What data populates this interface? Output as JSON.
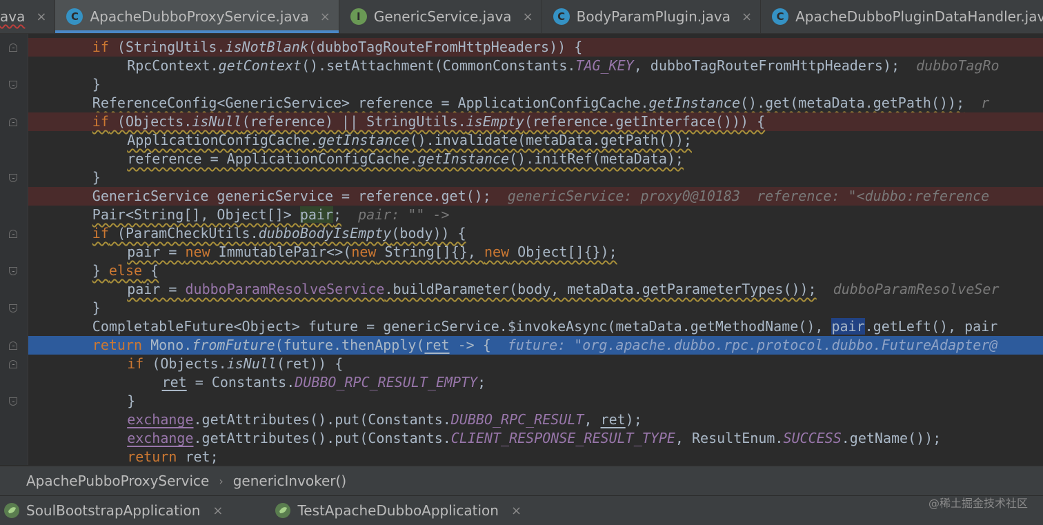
{
  "editor_tabs": [
    {
      "label": "ava",
      "type": "partial",
      "error": true
    },
    {
      "label": "ApacheDubboProxyService.java",
      "icon": "class-icon",
      "icon_letter": "C",
      "active": true
    },
    {
      "label": "GenericService.java",
      "icon": "interface-icon",
      "icon_letter": "I",
      "active": false
    },
    {
      "label": "BodyParamPlugin.java",
      "icon": "class-icon",
      "icon_letter": "C",
      "active": false
    },
    {
      "label": "ApacheDubboPluginDataHandler.java",
      "icon": "class-icon",
      "icon_letter": "C",
      "active": false
    }
  ],
  "tab_close_glyph": "×",
  "colors": {
    "class_icon": "#3592c4",
    "interface_icon": "#6a9955",
    "keyword": "#cc7832",
    "selection": "#2d5b9c",
    "breakpoint_line": "#4a2b2b"
  },
  "code": {
    "lines": [
      {
        "indent": 2,
        "highlight": "red",
        "fold": "down",
        "tokens": [
          {
            "t": "if",
            "c": "kw"
          },
          {
            "t": " (StringUtils."
          },
          {
            "t": "isNotBlank",
            "c": "it"
          },
          {
            "t": "(dubboTagRouteFromHttpHeaders)) {"
          }
        ]
      },
      {
        "indent": 3,
        "tokens": [
          {
            "t": "RpcContext."
          },
          {
            "t": "getContext",
            "c": "it"
          },
          {
            "t": "().setAttachment(CommonConstants."
          },
          {
            "t": "TAG_KEY",
            "c": "const"
          },
          {
            "t": ", dubboTagRouteFromHttpHeaders);"
          },
          {
            "t": "  dubboTagRo",
            "c": "inlay"
          }
        ]
      },
      {
        "indent": 2,
        "fold": "up",
        "tokens": [
          {
            "t": "}"
          }
        ]
      },
      {
        "indent": 2,
        "tokens": [
          {
            "t": "ReferenceConfig<GenericService> reference = ApplicationConfigCache.",
            "c": "wavy"
          },
          {
            "t": "getInstance",
            "c": "it wavy"
          },
          {
            "t": "().get(metaData.getPath());",
            "c": "wavy"
          },
          {
            "t": "  r",
            "c": "inlay"
          }
        ]
      },
      {
        "indent": 2,
        "highlight": "red",
        "fold": "down",
        "tokens": [
          {
            "t": "if",
            "c": "kw wavy"
          },
          {
            "t": " (Objects.",
            "c": "wavy"
          },
          {
            "t": "isNull",
            "c": "it wavy"
          },
          {
            "t": "(reference) || StringUtils.",
            "c": "wavy"
          },
          {
            "t": "isEmpty",
            "c": "it wavy"
          },
          {
            "t": "(reference.getInterface())) {",
            "c": "wavy"
          }
        ]
      },
      {
        "indent": 3,
        "tokens": [
          {
            "t": "ApplicationConfigCache.",
            "c": "wavy"
          },
          {
            "t": "getInstance",
            "c": "it wavy"
          },
          {
            "t": "().invalidate(metaData.getPath());",
            "c": "wavy"
          }
        ]
      },
      {
        "indent": 3,
        "tokens": [
          {
            "t": "reference = ApplicationConfigCache.",
            "c": "wavy"
          },
          {
            "t": "getInstance",
            "c": "it wavy"
          },
          {
            "t": "().initRef(metaData);",
            "c": "wavy"
          }
        ]
      },
      {
        "indent": 2,
        "fold": "up",
        "tokens": [
          {
            "t": "}"
          }
        ]
      },
      {
        "indent": 2,
        "highlight": "red",
        "tokens": [
          {
            "t": "GenericService genericService = reference.get();"
          },
          {
            "t": "  genericService: proxy0@10183  reference: \"<dubbo:reference",
            "c": "inlay"
          }
        ]
      },
      {
        "indent": 2,
        "tokens": [
          {
            "t": "Pair<String[], Object[]> ",
            "c": "wavy"
          },
          {
            "t": "pair",
            "c": "pair-var wavy"
          },
          {
            "t": ";",
            "c": "wavy"
          },
          {
            "t": "  pair: \"\" ->",
            "c": "inlay"
          }
        ]
      },
      {
        "indent": 2,
        "fold": "down",
        "tokens": [
          {
            "t": "if",
            "c": "kw wavy"
          },
          {
            "t": " (ParamCheckUtils.",
            "c": "wavy"
          },
          {
            "t": "dubboBodyIsEmpty",
            "c": "it wavy"
          },
          {
            "t": "(body)) {",
            "c": "wavy"
          }
        ]
      },
      {
        "indent": 3,
        "tokens": [
          {
            "t": "pair = ",
            "c": "wavy"
          },
          {
            "t": "new",
            "c": "kw wavy"
          },
          {
            "t": " ImmutablePair<>(",
            "c": "wavy"
          },
          {
            "t": "new",
            "c": "kw wavy"
          },
          {
            "t": " String[]{}, ",
            "c": "wavy"
          },
          {
            "t": "new",
            "c": "kw wavy"
          },
          {
            "t": " Object[]{});",
            "c": "wavy"
          }
        ]
      },
      {
        "indent": 2,
        "fold": "up",
        "tokens": [
          {
            "t": "} ",
            "c": "wavy"
          },
          {
            "t": "else",
            "c": "kw wavy"
          },
          {
            "t": " {",
            "c": "wavy"
          }
        ]
      },
      {
        "indent": 3,
        "tokens": [
          {
            "t": "pair = ",
            "c": "wavy"
          },
          {
            "t": "dubboParamResolveService",
            "c": "field wavy"
          },
          {
            "t": ".buildParameter(body, metaData.getParameterTypes());",
            "c": "wavy"
          },
          {
            "t": "  dubboParamResolveSer",
            "c": "inlay"
          }
        ]
      },
      {
        "indent": 2,
        "fold": "up",
        "tokens": [
          {
            "t": "}"
          }
        ]
      },
      {
        "indent": 2,
        "tokens": [
          {
            "t": "CompletableFuture<Object> future = genericService.$invokeAsync(metaData.getMethodName(), "
          },
          {
            "t": "pair",
            "c": "sel-word"
          },
          {
            "t": ".getLeft(), pair"
          }
        ]
      },
      {
        "indent": 2,
        "highlight": "sel",
        "fold": "down",
        "tokens": [
          {
            "t": "return",
            "c": "kw"
          },
          {
            "t": " Mono."
          },
          {
            "t": "fromFuture",
            "c": "it"
          },
          {
            "t": "(future.thenApply("
          },
          {
            "t": "ret",
            "c": "under"
          },
          {
            "t": " -> {"
          },
          {
            "t": "  future: \"org.apache.dubbo.rpc.protocol.dubbo.FutureAdapter@",
            "c": "inlay-sel"
          }
        ]
      },
      {
        "indent": 3,
        "fold": "down",
        "tokens": [
          {
            "t": "if",
            "c": "kw"
          },
          {
            "t": " (Objects."
          },
          {
            "t": "isNull",
            "c": "it"
          },
          {
            "t": "(ret)) {"
          }
        ]
      },
      {
        "indent": 4,
        "tokens": [
          {
            "t": "ret",
            "c": "under"
          },
          {
            "t": " = Constants."
          },
          {
            "t": "DUBBO_RPC_RESULT_EMPTY",
            "c": "const"
          },
          {
            "t": ";"
          }
        ]
      },
      {
        "indent": 3,
        "fold": "up",
        "tokens": [
          {
            "t": "}"
          }
        ]
      },
      {
        "indent": 3,
        "tokens": [
          {
            "t": "exchange",
            "c": "field under"
          },
          {
            "t": ".getAttributes().put(Constants."
          },
          {
            "t": "DUBBO_RPC_RESULT",
            "c": "const"
          },
          {
            "t": ", "
          },
          {
            "t": "ret",
            "c": "under"
          },
          {
            "t": ");"
          }
        ]
      },
      {
        "indent": 3,
        "tokens": [
          {
            "t": "exchange",
            "c": "field under"
          },
          {
            "t": ".getAttributes().put(Constants."
          },
          {
            "t": "CLIENT_RESPONSE_RESULT_TYPE",
            "c": "const"
          },
          {
            "t": ", ResultEnum."
          },
          {
            "t": "SUCCESS",
            "c": "const"
          },
          {
            "t": ".getName());"
          }
        ]
      },
      {
        "indent": 3,
        "tokens": [
          {
            "t": "return",
            "c": "kw"
          },
          {
            "t": " ret;"
          }
        ]
      }
    ]
  },
  "breadcrumb": {
    "class_name": "ApachePubboProxyService",
    "separator": "›",
    "method_name": "genericInvoker()"
  },
  "run_tabs": [
    {
      "label": "SoulBootstrapApplication"
    },
    {
      "label": "TestApacheDubboApplication"
    }
  ],
  "watermark": "@稀土掘金技术社区"
}
